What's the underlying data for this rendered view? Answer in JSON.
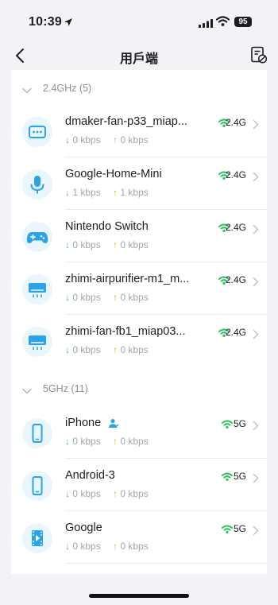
{
  "status_bar": {
    "time": "10:39",
    "battery": "95"
  },
  "nav": {
    "title": "用戶端"
  },
  "sections": [
    {
      "label": "2.4GHz (5)"
    },
    {
      "label": "5GHz (11)"
    }
  ],
  "devices": [
    {
      "name": "dmaker-fan-p33_miap...",
      "down": "0 kbps",
      "up": "0 kbps",
      "band": "2.4G",
      "icon": "device-box-icon"
    },
    {
      "name": "Google-Home-Mini",
      "down": "1 kbps",
      "up": "1 kbps",
      "band": "2.4G",
      "icon": "microphone-icon"
    },
    {
      "name": "Nintendo Switch",
      "down": "0 kbps",
      "up": "0 kbps",
      "band": "2.4G",
      "icon": "gamepad-icon"
    },
    {
      "name": "zhimi-airpurifier-m1_m...",
      "down": "0 kbps",
      "up": "0 kbps",
      "band": "2.4G",
      "icon": "air-conditioner-icon"
    },
    {
      "name": "zhimi-fan-fb1_miap03...",
      "down": "0 kbps",
      "up": "0 kbps",
      "band": "2.4G",
      "icon": "air-conditioner-icon"
    },
    {
      "name": "iPhone",
      "down": "0 kbps",
      "up": "0 kbps",
      "band": "5G",
      "icon": "smartphone-icon",
      "owner_icon": "person-icon"
    },
    {
      "name": "Android-3",
      "down": "0 kbps",
      "up": "0 kbps",
      "band": "5G",
      "icon": "smartphone-icon"
    },
    {
      "name": "Google",
      "down": "0 kbps",
      "up": "0 kbps",
      "band": "5G",
      "icon": "media-player-icon"
    }
  ],
  "colors": {
    "accent_blue": "#2aa3e8",
    "wifi_green": "#29c15c",
    "down_arrow": "#47c46b",
    "up_arrow": "#f0a431",
    "icon_bg": "#e9f6fd"
  }
}
